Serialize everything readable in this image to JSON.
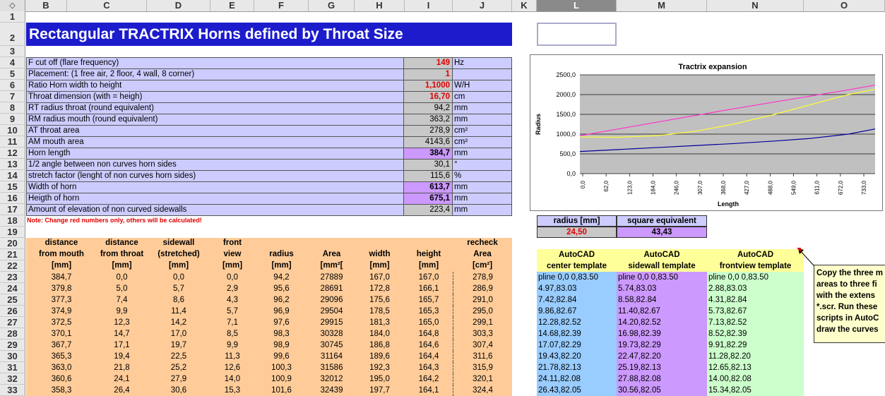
{
  "columns": [
    "B",
    "C",
    "D",
    "E",
    "F",
    "G",
    "H",
    "I",
    "J",
    "K",
    "L",
    "M",
    "N",
    "O"
  ],
  "corner_icon": "diamond-arrows-icon",
  "rows": [
    "1",
    "2",
    "3",
    "4",
    "5",
    "6",
    "7",
    "8",
    "9",
    "10",
    "11",
    "12",
    "13",
    "14",
    "15",
    "16",
    "17",
    "18",
    "19",
    "20",
    "21",
    "22",
    "23",
    "24",
    "25",
    "26",
    "27",
    "28",
    "29",
    "30",
    "31",
    "32",
    "33"
  ],
  "title": "Rectangular TRACTRIX Horns defined by Throat Size",
  "params": [
    {
      "label": "F cut off (flare frequency)",
      "value": "149",
      "unit": "Hz",
      "style": "red"
    },
    {
      "label": "Placement: (1 free air, 2 floor, 4 wall, 8 corner)",
      "value": "1",
      "unit": "",
      "style": "red"
    },
    {
      "label": "Ratio Horn width to height",
      "value": "1,1000",
      "unit": "W/H",
      "style": "red"
    },
    {
      "label": "Throat dimension (with = heigh)",
      "value": "16,70",
      "unit": "cm",
      "style": "red"
    },
    {
      "label": "RT radius throat (round equivalent)",
      "value": "94,2",
      "unit": "mm",
      "style": "grey"
    },
    {
      "label": "RM radius mouth (round equivalent)",
      "value": "363,2",
      "unit": "mm",
      "style": "grey"
    },
    {
      "label": "AT throat area",
      "value": "278,9",
      "unit": "cm²",
      "style": "grey"
    },
    {
      "label": "AM mouth area",
      "value": "4143,6",
      "unit": "cm²",
      "style": "grey"
    },
    {
      "label": "Horn length",
      "value": "384,7",
      "unit": "mm",
      "style": "purple"
    },
    {
      "label": "1/2 angle between non curves horn sides",
      "value": "30,1",
      "unit": "°",
      "style": "grey"
    },
    {
      "label": "stretch factor (lenght of non curves horn sides)",
      "value": "115,6",
      "unit": "%",
      "style": "grey"
    },
    {
      "label": "Width of horn",
      "value": "613,7",
      "unit": "mm",
      "style": "purple"
    },
    {
      "label": "Heigth of horn",
      "value": "675,1",
      "unit": "mm",
      "style": "purple"
    },
    {
      "label": "Amount of elevation of non curved sidewalls",
      "value": "223,4",
      "unit": "mm",
      "style": "grey"
    }
  ],
  "note": "Note: Change red numbers only, others will be calculated!",
  "table_headers": [
    [
      "distance",
      "from mouth",
      "[mm]"
    ],
    [
      "distance",
      "from throat",
      "[mm]"
    ],
    [
      "sidewall",
      "(stretched)",
      "[mm]"
    ],
    [
      "front",
      "view",
      "[mm]"
    ],
    [
      "",
      "radius",
      "[mm]"
    ],
    [
      "",
      "Area",
      "[mm²["
    ],
    [
      "",
      "width",
      "[mm]"
    ],
    [
      "",
      "height",
      "[mm]"
    ],
    [
      "recheck",
      "Area",
      "[cm²]"
    ]
  ],
  "table_rows": [
    [
      "384,7",
      "0,0",
      "0,0",
      "0,0",
      "94,2",
      "27889",
      "167,0",
      "167,0",
      "278,9"
    ],
    [
      "379,8",
      "5,0",
      "5,7",
      "2,9",
      "95,6",
      "28691",
      "172,8",
      "166,1",
      "286,9"
    ],
    [
      "377,3",
      "7,4",
      "8,6",
      "4,3",
      "96,2",
      "29096",
      "175,6",
      "165,7",
      "291,0"
    ],
    [
      "374,9",
      "9,9",
      "11,4",
      "5,7",
      "96,9",
      "29504",
      "178,5",
      "165,3",
      "295,0"
    ],
    [
      "372,5",
      "12,3",
      "14,2",
      "7,1",
      "97,6",
      "29915",
      "181,3",
      "165,0",
      "299,1"
    ],
    [
      "370,1",
      "14,7",
      "17,0",
      "8,5",
      "98,3",
      "30328",
      "184,0",
      "164,8",
      "303,3"
    ],
    [
      "367,7",
      "17,1",
      "19,7",
      "9,9",
      "98,9",
      "30745",
      "186,8",
      "164,6",
      "307,4"
    ],
    [
      "365,3",
      "19,4",
      "22,5",
      "11,3",
      "99,6",
      "31164",
      "189,6",
      "164,4",
      "311,6"
    ],
    [
      "363,0",
      "21,8",
      "25,2",
      "12,6",
      "100,3",
      "31586",
      "192,3",
      "164,3",
      "315,9"
    ],
    [
      "360,6",
      "24,1",
      "27,9",
      "14,0",
      "100,9",
      "32012",
      "195,0",
      "164,2",
      "320,1"
    ],
    [
      "358,3",
      "26,4",
      "30,6",
      "15,3",
      "101,6",
      "32439",
      "197,7",
      "164,1",
      "324,4"
    ]
  ],
  "radius_box": {
    "h1": "radius [mm]",
    "h2": "square equivalent",
    "v1": "24,50",
    "v2": "43,43"
  },
  "autocad": {
    "headers": [
      [
        "AutoCAD",
        "center template"
      ],
      [
        "AutoCAD",
        "sidewall template"
      ],
      [
        "AutoCAD",
        "frontview template"
      ]
    ],
    "center": [
      "pline 0,0 0,83.50",
      "4.97,83.03",
      "7.42,82.84",
      "9.86,82.67",
      "12.28,82.52",
      "14.68,82.39",
      "17.07,82.29",
      "19.43,82.20",
      "21.78,82.13",
      "24.11,82.08",
      "26.43,82.05"
    ],
    "sidewall": [
      "pline 0,0 0,83.50",
      "5.74,83.03",
      "8.58,82.84",
      "11.40,82.67",
      "14.20,82.52",
      "16.98,82.39",
      "19.73,82.29",
      "22.47,82.20",
      "25.19,82.13",
      "27.88,82.08",
      "30.56,82.05"
    ],
    "frontview": [
      "pline 0,0 0,83.50",
      "2.88,83.03",
      "4.31,82.84",
      "5.73,82.67",
      "7.13,82.52",
      "8.52,82.39",
      "9.91,82.29",
      "11.28,82.20",
      "12.65,82.13",
      "14.00,82.08",
      "15.34,82.05"
    ]
  },
  "comment_lines": [
    "Copy the three m",
    "areas to three fi",
    "with the extens",
    "*.scr. Run these",
    "scripts in AutoC",
    "draw the curves"
  ],
  "chart_data": {
    "type": "line",
    "title": "Tractrix expansion",
    "xlabel": "Length",
    "ylabel": "Radius",
    "y_ticks": [
      "2500,0",
      "2000,0",
      "1500,0",
      "1000,0",
      "500,0",
      "0,0"
    ],
    "x_ticks": [
      "0,0",
      "62,0",
      "123,0",
      "184,0",
      "246,0",
      "307,0",
      "368,0",
      "427,0",
      "488,0",
      "549,0",
      "611,0",
      "672,0",
      "733,0"
    ],
    "ylim": [
      0,
      2500
    ],
    "xlim": [
      0,
      770
    ],
    "grid": "horizontal",
    "plot_background": "#c0c0c0",
    "series": [
      {
        "color": "#ff33cc",
        "x": [
          0,
          100,
          200,
          300,
          400,
          500,
          600,
          700,
          770
        ],
        "y": [
          960,
          1130,
          1300,
          1470,
          1640,
          1800,
          1960,
          2120,
          2240
        ]
      },
      {
        "color": "#ffff33",
        "x": [
          0,
          100,
          200,
          300,
          400,
          500,
          600,
          700,
          770
        ],
        "y": [
          930,
          920,
          960,
          1070,
          1250,
          1480,
          1740,
          2000,
          2130
        ]
      },
      {
        "color": "#000099",
        "x": [
          0,
          100,
          200,
          300,
          400,
          500,
          600,
          700,
          770
        ],
        "y": [
          560,
          610,
          660,
          710,
          760,
          820,
          890,
          1000,
          1130
        ]
      }
    ]
  }
}
